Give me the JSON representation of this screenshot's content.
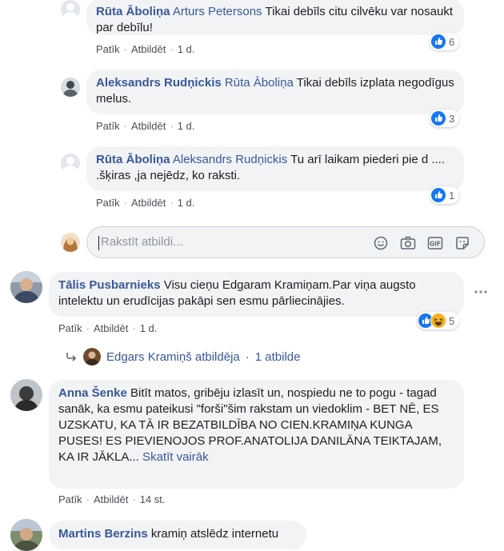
{
  "comments": [
    {
      "author": "Rūta Āboliņa",
      "mention": "Arturs Petersons",
      "text": " Tikai debīls citu cilvēku var nosaukt par debīlu!",
      "like_label": "Patīk",
      "reply_label": "Atbildēt",
      "time": "1 d.",
      "reaction_count": "6"
    },
    {
      "author": "Aleksandrs Rudņickis",
      "mention": "Rūta Āboliņa",
      "text": " Tikai debīls izplata negodīgus melus.",
      "like_label": "Patīk",
      "reply_label": "Atbildēt",
      "time": "1 d.",
      "reaction_count": "3"
    },
    {
      "author": "Rūta Āboliņa",
      "mention": "Aleksandrs Rudņickis",
      "text": " Tu arī laikam piederi pie d .... .šķiras ,ja nejēdz, ko raksti.",
      "like_label": "Patīk",
      "reply_label": "Atbildēt",
      "time": "1 d.",
      "reaction_count": "1"
    },
    {
      "author": "Tālis Pusbarnieks",
      "text": " Visu cieņu Edgaram Kramiņam.Par viņa augsto intelektu un erudīcijas pakāpi sen esmu pārliecinājies.",
      "like_label": "Patīk",
      "reply_label": "Atbildēt",
      "time": "1 d.",
      "reaction_count": "5"
    },
    {
      "author": "Anna Šenke",
      "text": " Bitīt matos, gribēju izlasīt un, nospiedu ne to pogu - tagad sanāk, ka esmu pateikusi \"forši\"šim rakstam un viedoklim - BET NĒ, ES UZSKATU, KA TĀ IR BEZATBILDĪBA NO CIEN.KRAMIŅA KUNGA PUSES! ES PIEVIENOJOS PROF.ANATOLIJA DANILĀNA TEIKTAJAM, KA IR JĀKLA...",
      "see_more": " Skatīt vairāk",
      "like_label": "Patīk",
      "reply_label": "Atbildēt",
      "time": "14 st."
    },
    {
      "author": "Martins Berzins",
      "text": " kramiņ atslēdz internetu"
    }
  ],
  "reply_box": {
    "placeholder": "Rakstīt atbildi..."
  },
  "replies": {
    "text": "Edgars Kramiņš atbildēja",
    "separator": "·",
    "count": "1 atbilde"
  },
  "colors": {
    "link": "#385898",
    "bubble": "#f2f3f5",
    "like_blue": "#1877f2",
    "haha_yellow": "#f7b125"
  },
  "icons": [
    "like-icon",
    "haha-icon",
    "emoji-icon",
    "camera-icon",
    "gif-icon",
    "sticker-icon",
    "reply-arrow-icon",
    "more-options-icon"
  ]
}
